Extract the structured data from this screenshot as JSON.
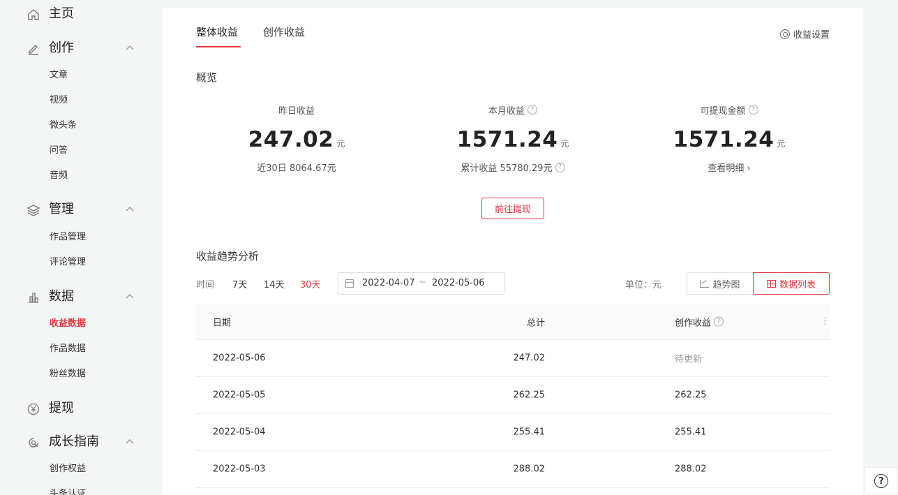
{
  "sidebar": {
    "home": "主页",
    "create": {
      "label": "创作",
      "items": [
        "文章",
        "视频",
        "微头条",
        "问答",
        "音频"
      ]
    },
    "manage": {
      "label": "管理",
      "items": [
        "作品管理",
        "评论管理"
      ]
    },
    "data": {
      "label": "数据",
      "items": [
        "收益数据",
        "作品数据",
        "粉丝数据"
      ],
      "active": "收益数据"
    },
    "withdraw": "提现",
    "growth": {
      "label": "成长指南",
      "items": [
        "创作权益",
        "头条认证"
      ]
    }
  },
  "tabs": [
    "整体收益",
    "创作收益"
  ],
  "settings_label": "收益设置",
  "overview": {
    "title": "概览",
    "yesterday": {
      "caption": "昨日收益",
      "value": "247.02",
      "unit": "元",
      "sub": "近30日 8064.67元"
    },
    "month": {
      "caption": "本月收益",
      "value": "1571.24",
      "unit": "元",
      "sub": "累计收益 55780.29元"
    },
    "withdrawable": {
      "caption": "可提现金额",
      "value": "1571.24",
      "unit": "元",
      "sub": "查看明细 ›"
    },
    "withdraw_button": "前往提现"
  },
  "trend": {
    "title": "收益趋势分析",
    "time_label": "时间",
    "ranges": [
      "7天",
      "14天",
      "30天"
    ],
    "active_range": "30天",
    "date_start": "2022-04-07",
    "date_sep": "~",
    "date_end": "2022-05-06",
    "unit_label": "单位：元",
    "view_trend": "趋势图",
    "view_list": "数据列表"
  },
  "table": {
    "headers": [
      "日期",
      "总计",
      "创作收益"
    ],
    "rows": [
      {
        "date": "2022-05-06",
        "total": "247.02",
        "create": "待更新"
      },
      {
        "date": "2022-05-05",
        "total": "262.25",
        "create": "262.25"
      },
      {
        "date": "2022-05-04",
        "total": "255.41",
        "create": "255.41"
      },
      {
        "date": "2022-05-03",
        "total": "288.02",
        "create": "288.02"
      }
    ]
  },
  "accent_color": "#e4383f"
}
